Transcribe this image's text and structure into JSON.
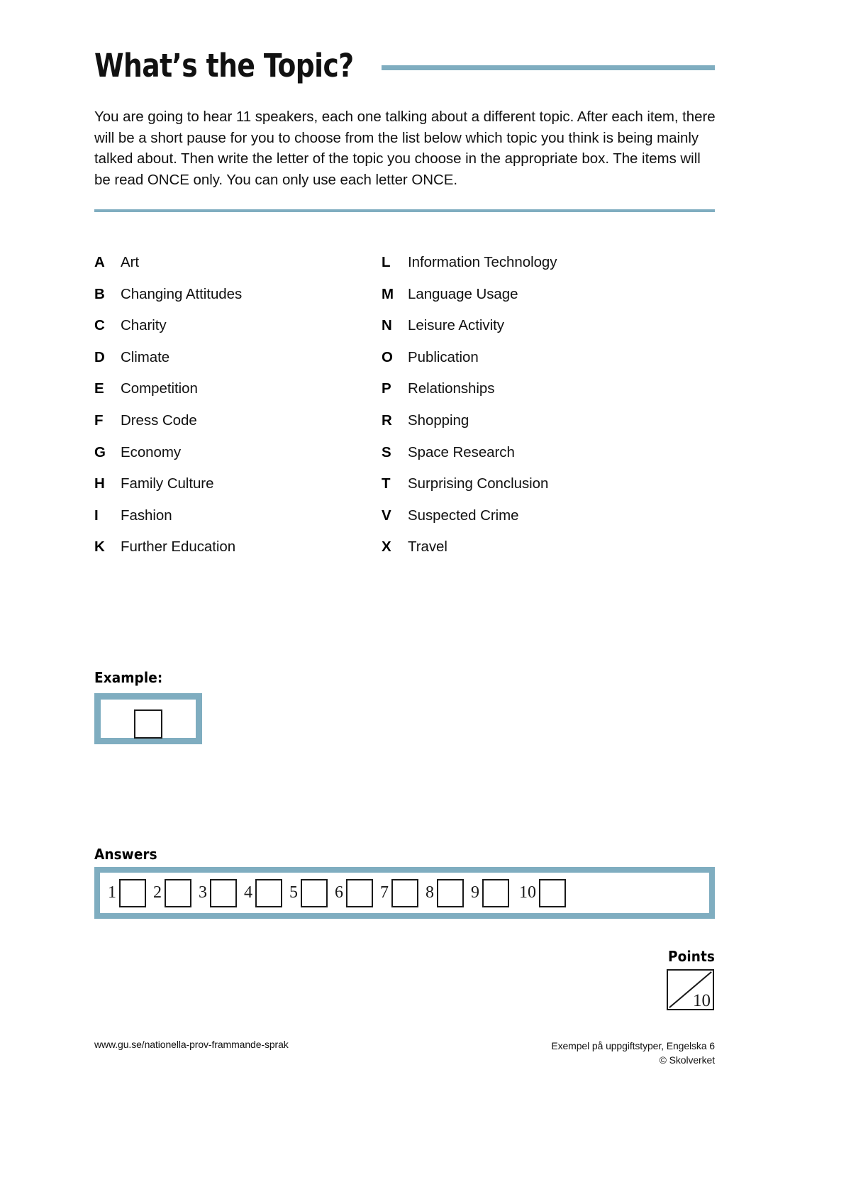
{
  "header": {
    "title": "What’s the Topic?",
    "accent_color": "#7fadc0"
  },
  "intro": {
    "text": "You are going to hear 11 speakers, each one talking about a different topic. After each item, there will be a short pause for you to choose from the list below which topic you think is being mainly talked about. Then write the letter of the topic you choose in the appropriate box. The items will be read ONCE only. You can only use each letter ONCE."
  },
  "topics": {
    "left_column": [
      {
        "letter": "A",
        "label": "Art"
      },
      {
        "letter": "B",
        "label": "Changing Attitudes"
      },
      {
        "letter": "C",
        "label": "Charity"
      },
      {
        "letter": "D",
        "label": "Climate"
      },
      {
        "letter": "E",
        "label": "Competition"
      },
      {
        "letter": "F",
        "label": "Dress Code"
      },
      {
        "letter": "G",
        "label": "Economy"
      },
      {
        "letter": "H",
        "label": "Family Culture"
      },
      {
        "letter": "I",
        "label": "Fashion"
      },
      {
        "letter": "K",
        "label": "Further Education"
      }
    ],
    "right_column": [
      {
        "letter": "L",
        "label": "Information Technology"
      },
      {
        "letter": "M",
        "label": "Language Usage"
      },
      {
        "letter": "N",
        "label": "Leisure Activity"
      },
      {
        "letter": "O",
        "label": "Publication"
      },
      {
        "letter": "P",
        "label": "Relationships"
      },
      {
        "letter": "R",
        "label": "Shopping"
      },
      {
        "letter": "S",
        "label": "Space Research"
      },
      {
        "letter": "T",
        "label": "Surprising Conclusion"
      },
      {
        "letter": "V",
        "label": "Suspected Crime"
      },
      {
        "letter": "X",
        "label": "Travel"
      }
    ]
  },
  "example": {
    "label": "Example:",
    "value": ""
  },
  "answers": {
    "label": "Answers",
    "items": [
      {
        "number": "1",
        "value": ""
      },
      {
        "number": "2",
        "value": ""
      },
      {
        "number": "3",
        "value": ""
      },
      {
        "number": "4",
        "value": ""
      },
      {
        "number": "5",
        "value": ""
      },
      {
        "number": "6",
        "value": ""
      },
      {
        "number": "7",
        "value": ""
      },
      {
        "number": "8",
        "value": ""
      },
      {
        "number": "9",
        "value": ""
      },
      {
        "number": "10",
        "value": ""
      }
    ]
  },
  "points": {
    "label": "Points",
    "max": "10",
    "earned": ""
  },
  "footer": {
    "left": "www.gu.se/nationella-prov-frammande-sprak",
    "right_line1": "Exempel på uppgiftstyper, Engelska 6",
    "right_line2": "© Skolverket"
  }
}
